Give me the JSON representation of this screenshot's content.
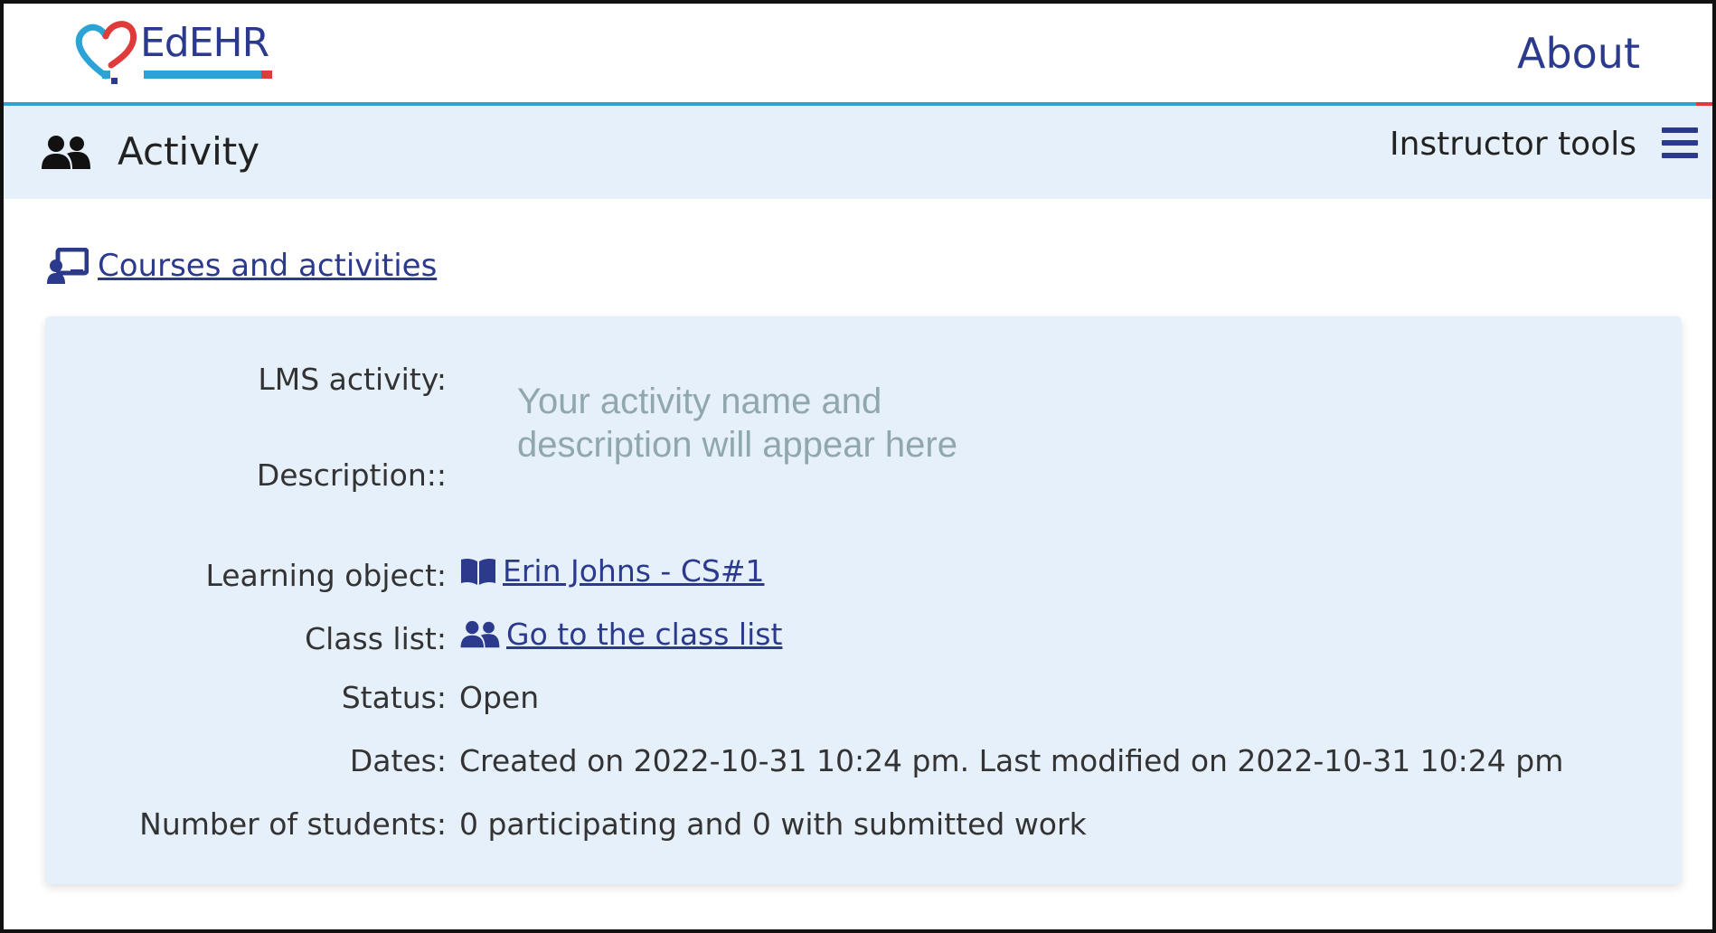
{
  "header": {
    "logo_text": "EdEHR",
    "about_label": "About"
  },
  "subheader": {
    "title": "Activity",
    "tools_label": "Instructor tools"
  },
  "breadcrumb": {
    "back_label": " Courses and activities"
  },
  "activity": {
    "lms_activity_label": "LMS activity:",
    "description_label": "Description::",
    "placeholder_text": "Your activity name and description will appear here",
    "learning_object_label": "Learning object:",
    "learning_object_value": " Erin Johns - CS#1",
    "class_list_label": "Class list:",
    "class_list_value": " Go to the class list",
    "status_label": "Status:",
    "status_value": "Open",
    "dates_label": "Dates:",
    "dates_value": "Created on 2022-10-31 10:24 pm. Last modified on 2022-10-31 10:24 pm",
    "students_label": "Number of students:",
    "students_value": "0 participating and 0 with submitted work"
  },
  "colors": {
    "brand_blue": "#2b3a8c",
    "accent_cyan": "#2ca3d6",
    "accent_red": "#e03b3b",
    "panel_bg": "#e6f0fa",
    "placeholder_gray": "#8fa7ad"
  }
}
